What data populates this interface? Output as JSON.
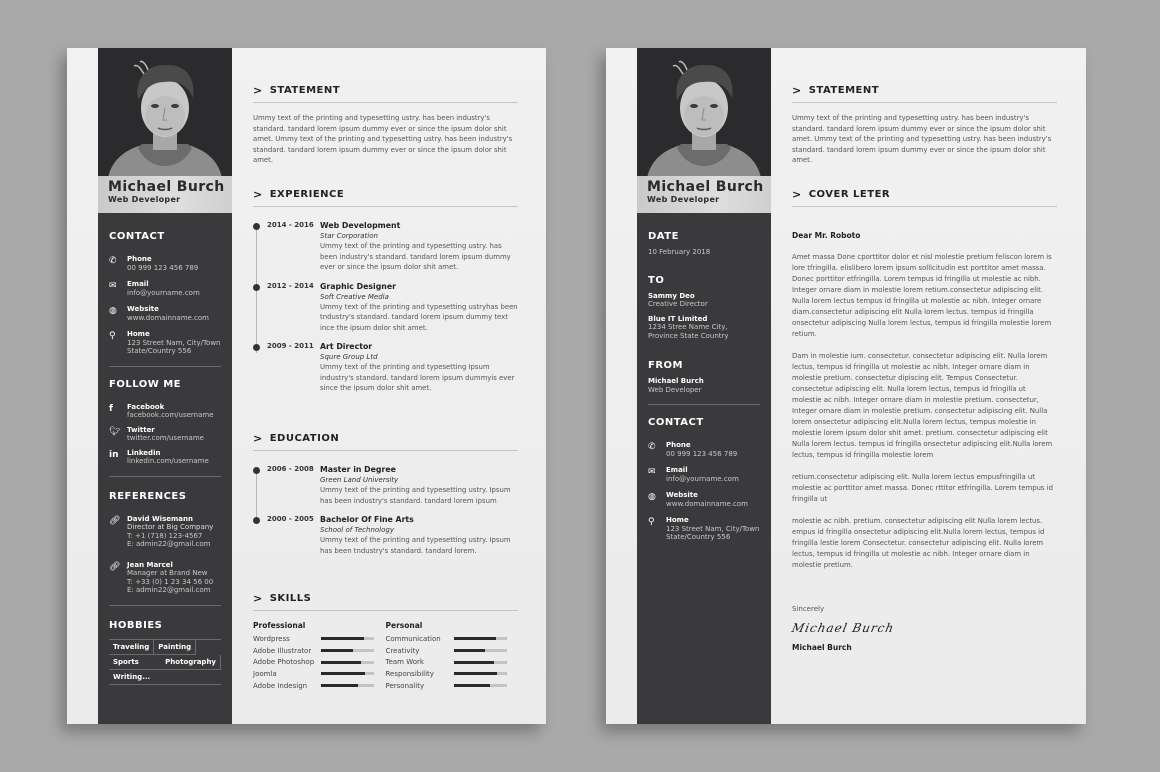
{
  "resume": {
    "name": "Michael Burch",
    "role": "Web Developer",
    "contact": {
      "title": "CONTACT",
      "items": [
        {
          "icon": "phone-icon",
          "label": "Phone",
          "value": "00 999 123 456 789"
        },
        {
          "icon": "envelope-icon",
          "label": "Email",
          "value": "info@yourname.com"
        },
        {
          "icon": "globe-icon",
          "label": "Website",
          "value": "www.domainname.com"
        },
        {
          "icon": "map-pin-icon",
          "label": "Home",
          "value": "123 Street Nam, City/Town",
          "value2": "State/Country 556"
        }
      ]
    },
    "follow": {
      "title": "FOLLOW ME",
      "items": [
        {
          "icon": "facebook-icon",
          "label": "Facebook",
          "value": "facebook.com/username"
        },
        {
          "icon": "twitter-icon",
          "label": "Twitter",
          "value": "twitter.com/username"
        },
        {
          "icon": "linkedin-icon",
          "label": "Linkedin",
          "value": "linkedin.com/username"
        }
      ]
    },
    "references": {
      "title": "REFERENCES",
      "items": [
        {
          "name": "David Wisemann",
          "position": "Director at Big Company",
          "phone": "T:  +1 (718) 123-4567",
          "email": "E: admin22@gmail.com"
        },
        {
          "name": "Jean Marcel",
          "position": "Manager at Brand New",
          "phone": "T: +33 (0) 1 23 34 56 00",
          "email": "E:  admin22@gmail.com"
        }
      ]
    },
    "hobbies": {
      "title": "HOBBIES",
      "items": [
        "Traveling",
        "Painting",
        "Sports",
        "Photography",
        "Writing..."
      ]
    },
    "statement": {
      "title": "STATEMENT",
      "text": "Ummy text of the printing and typesetting ustry. has been industry's standard. tandard lorem ipsum dummy ever or since the ipsum dolor shit amet. Ummy text of the printing and typesetting ustry. has been industry's standard. tandard lorem ipsum dummy ever or since the ipsum dolor shit amet."
    },
    "experience": {
      "title": "EXPERIENCE",
      "items": [
        {
          "dates": "2014 - 2016",
          "title": "Web Development",
          "org": "Star Corporation",
          "desc": "Ummy text of the printing and typesetting ustry.  has been industry's standard. tandard lorem ipsum dummy ever or since the ipsum dolor shit amet."
        },
        {
          "dates": "2012 - 2014",
          "title": "Graphic Designer",
          "org": "Soft Creative Media",
          "desc": "Ummy text of the printing and typesetting ustryhas been tndustry's standard. tandard lorem ipsum dummy text ince the ipsum dolor shit amet."
        },
        {
          "dates": "2009 - 2011",
          "title": "Art Director",
          "org": "Squre Group Ltd",
          "desc": "Ummy text of the printing and typesetting  Ipsum industry's standard. tandard lorem ipsum dummyis ever since the ipsum dolor shit amet."
        }
      ]
    },
    "education": {
      "title": "EDUCATION",
      "items": [
        {
          "dates": "2006 - 2008",
          "title": "Master in Degree",
          "org": "Green Land University",
          "desc": "Ummy text of the printing and typesetting ustry. Ipsum has been industry's standard. tandard lorem ipsum"
        },
        {
          "dates": "2000 - 2005",
          "title": "Bachelor Of Fine Arts",
          "org": "School of Technology",
          "desc": "Ummy text of the printing and typesetting ustry. Ipsum has been tndustry's standard. tandard lorem."
        }
      ]
    },
    "skills": {
      "title": "SKILLS",
      "professional": {
        "title": "Professional",
        "items": [
          {
            "name": "Wordpress",
            "level": 0.81
          },
          {
            "name": "Adobe Illustrator",
            "level": 0.6
          },
          {
            "name": "Adobe Photoshop",
            "level": 0.76
          },
          {
            "name": "Joomla",
            "level": 0.83
          },
          {
            "name": "Adobe Indesign",
            "level": 0.69
          }
        ]
      },
      "personal": {
        "title": "Personal",
        "items": [
          {
            "name": "Communication",
            "level": 0.81
          },
          {
            "name": "Creativity",
            "level": 0.6
          },
          {
            "name": "Team Work",
            "level": 0.76
          },
          {
            "name": "Responsibility",
            "level": 0.83
          },
          {
            "name": "Personality",
            "level": 0.69
          }
        ]
      }
    }
  },
  "cover": {
    "name": "Michael Burch",
    "role": "Web Developer",
    "date": {
      "title": "DATE",
      "value": "10 February 2018"
    },
    "to": {
      "title": "TO",
      "name": "Sammy Deo",
      "position": "Creative Director",
      "company": "Blue IT Limited",
      "address1": "1234 Stree Name City,",
      "address2": "Province State Country"
    },
    "from": {
      "title": "FROM",
      "name": "Michael Burch",
      "position": "Web Developer"
    },
    "contact": {
      "title": "CONTACT",
      "items": [
        {
          "icon": "phone-icon",
          "label": "Phone",
          "value": "00 999 123 456 789"
        },
        {
          "icon": "envelope-icon",
          "label": "Email",
          "value": "info@yourname.com"
        },
        {
          "icon": "globe-icon",
          "label": "Website",
          "value": "www.domainname.com"
        },
        {
          "icon": "map-pin-icon",
          "label": "Home",
          "value": "123 Street Nam, City/Town",
          "value2": "State/Country 556"
        }
      ]
    },
    "statement": {
      "title": "STATEMENT",
      "text": "Ummy text of the printing and typesetting ustry. has been industry's standard. tandard lorem ipsum dummy ever or since the ipsum dolor shit amet. Ummy text of the printing and typesetting ustry. has been industry's standard. tandard lorem ipsum dummy ever or since the ipsum dolor shit amet."
    },
    "letter": {
      "title": "COVER LETER",
      "greeting": "Dear Mr. Roboto",
      "paragraphs": [
        "Amet massa Done cporttitor dolor et nisl molestie pretium feliscon lorem is lore  tfringilla.  elislibero lorem ipsum sollicitudin est porttitor amet massa. Donec porttitor etfringilla. Lorem tempus id fringilla ut molestie ac nibh. Integer ornare diam in molestie lorem retium.consectetur adipiscing elit. Nulla lorem lectus tempus id fringilla ut molestie ac nibh. Integer ornare diam.consectetur adipiscing elit Nulla lorem lectus.  tempus id fringilla onsectetur adipiscing Nulla lorem lectus, tempus id fringilla molestie lorem retium.",
        "Dam in molestie  ium. consectetur. consectetur adipiscing elit. Nulla lorem lectus, tempus id fringilla ut molestie ac nibh. Integer ornare diam in molestie pretium. consectetur dipiscing elit. Tempus Consectetur. consectetur adipiscing elit. Nulla lorem lectus, tempus id fringilla ut molestie ac nibh. Integer ornare diam in molestie pretium. consectetur, Integer ornare diam in molestie pretium. consectetur adipiscing elit. Nulla lorem  onsectetur adipiscing elit.Nulla lorem lectus, tempus molestie in molestie lorem ipsum dolor shit amet. pretium. consectetur adipiscing elit Nulla lorem lectus.  tempus id fringilla onsectetur adipiscing elit.Nulla lorem lectus, tempus id fringilla molestie lorem",
        "retium.consectetur adipiscing elit. Nulla lorem lectus empusfringilla ut molestie ac porttitor amet massa. Donec rttitor etfringilla. Lorem tempus id fringilla ut",
        "molestie ac nibh. pretium. consectetur adipiscing elit Nulla lorem lectus.  empus id fringilla onsectetur adipiscing elit.Nulla lorem lectus, tempus id fringilla lestie lorem Consectetur. consectetur adipiscing elit. Nulla lorem lectus, tempus id fringilla ut molestie ac nibh. Integer ornare diam in molestie pretium."
      ],
      "closing": "Sincerely",
      "signature": "Michael Burch",
      "signer": "Michael Burch"
    }
  }
}
